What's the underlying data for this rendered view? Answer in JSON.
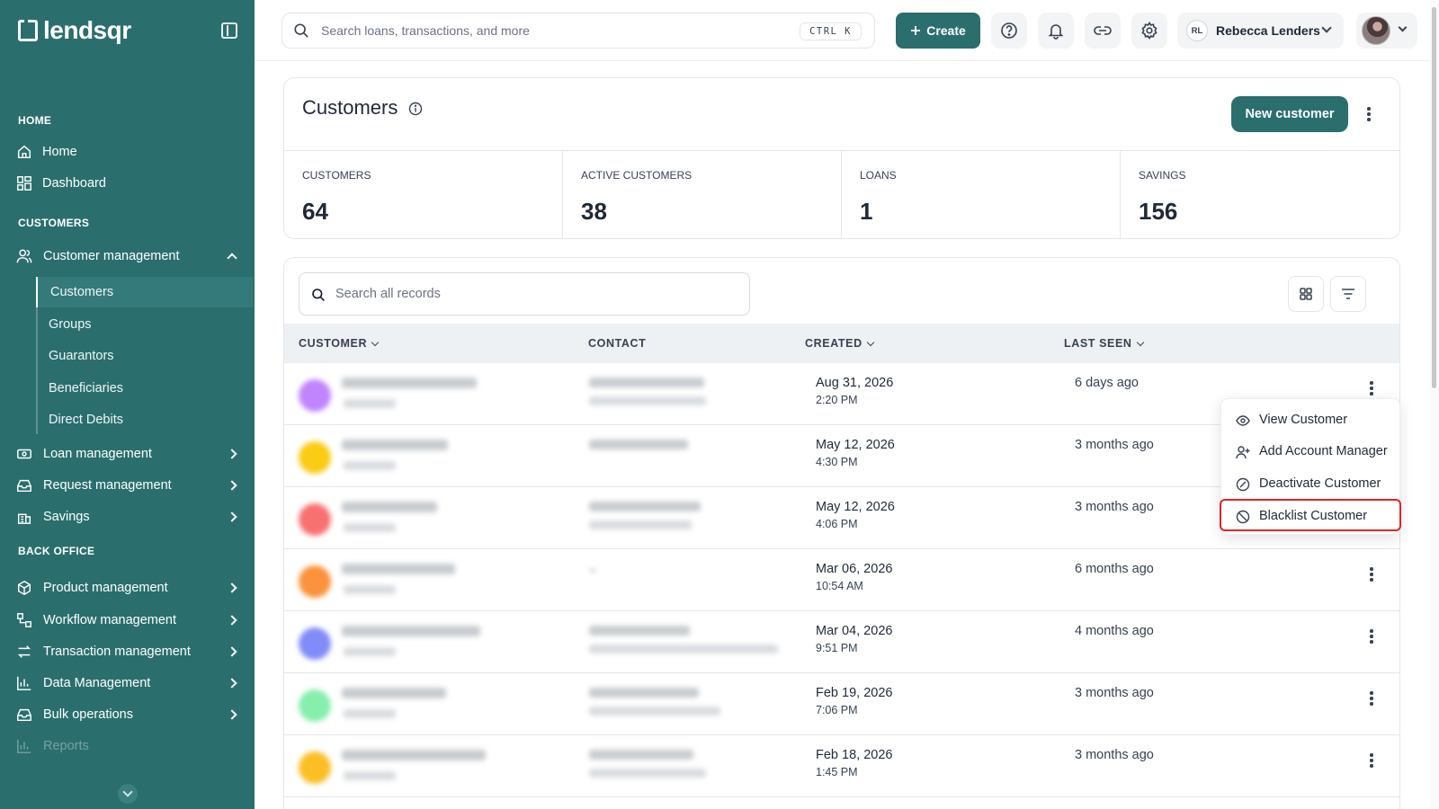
{
  "brand": {
    "name": "lendsqr"
  },
  "sidebar": {
    "sections": [
      {
        "title": "HOME"
      },
      {
        "title": "CUSTOMERS"
      },
      {
        "title": "BACK OFFICE"
      }
    ],
    "items": [
      {
        "label": "Home",
        "icon": "home-icon"
      },
      {
        "label": "Dashboard",
        "icon": "dashboard-icon"
      },
      {
        "label": "Customer management",
        "icon": "users-icon",
        "expanded": true
      },
      {
        "label": "Loan management",
        "icon": "loan-icon"
      },
      {
        "label": "Request management",
        "icon": "inbox-icon"
      },
      {
        "label": "Savings",
        "icon": "bank-icon"
      },
      {
        "label": "Product management",
        "icon": "box-icon"
      },
      {
        "label": "Workflow management",
        "icon": "workflow-icon"
      },
      {
        "label": "Transaction management",
        "icon": "arrows-icon"
      },
      {
        "label": "Data Management",
        "icon": "chart-icon"
      },
      {
        "label": "Bulk operations",
        "icon": "inbox-icon"
      },
      {
        "label": "Reports",
        "icon": "chart-icon"
      }
    ],
    "sub_items": [
      {
        "label": "Customers",
        "active": true
      },
      {
        "label": "Groups"
      },
      {
        "label": "Guarantors"
      },
      {
        "label": "Beneficiaries"
      },
      {
        "label": "Direct Debits"
      }
    ]
  },
  "topbar": {
    "search_placeholder": "Search loans, transactions, and more",
    "shortcut": "CTRL K",
    "create_label": "Create",
    "user_initials": "RL",
    "user_name": "Rebecca Lenders"
  },
  "page": {
    "title": "Customers",
    "new_button": "New customer",
    "stats": [
      {
        "label": "CUSTOMERS",
        "value": "64"
      },
      {
        "label": "ACTIVE CUSTOMERS",
        "value": "38"
      },
      {
        "label": "LOANS",
        "value": "1"
      },
      {
        "label": "SAVINGS",
        "value": "156"
      }
    ]
  },
  "table": {
    "search_placeholder": "Search all records",
    "columns": [
      "CUSTOMER",
      "CONTACT",
      "CREATED",
      "LAST SEEN"
    ],
    "rows": [
      {
        "created_date": "Aug 31, 2026",
        "created_time": "2:20 PM",
        "last_seen": "6 days ago",
        "avatar_color": "#c084fc"
      },
      {
        "created_date": "May 12, 2026",
        "created_time": "4:30 PM",
        "last_seen": "3 months ago",
        "avatar_color": "#facc15"
      },
      {
        "created_date": "May 12, 2026",
        "created_time": "4:06 PM",
        "last_seen": "3 months ago",
        "avatar_color": "#f87171"
      },
      {
        "created_date": "Mar 06, 2026",
        "created_time": "10:54 AM",
        "last_seen": "6 months ago",
        "avatar_color": "#fb923c"
      },
      {
        "created_date": "Mar 04, 2026",
        "created_time": "9:51 PM",
        "last_seen": "4 months ago",
        "avatar_color": "#818cf8"
      },
      {
        "created_date": "Feb 19, 2026",
        "created_time": "7:06 PM",
        "last_seen": "3 months ago",
        "avatar_color": "#86efac"
      },
      {
        "created_date": "Feb 18, 2026",
        "created_time": "1:45 PM",
        "last_seen": "3 months ago",
        "avatar_color": "#fbbf24"
      }
    ]
  },
  "row_menu": {
    "items": [
      {
        "label": "View Customer",
        "icon": "eye-icon"
      },
      {
        "label": "Add Account Manager",
        "icon": "user-plus-icon"
      },
      {
        "label": "Deactivate Customer",
        "icon": "deactivate-icon"
      },
      {
        "label": "Blacklist Customer",
        "icon": "ban-icon",
        "highlighted": true
      }
    ]
  },
  "colors": {
    "brand": "#2b6e6e",
    "highlight": "#e02424"
  }
}
